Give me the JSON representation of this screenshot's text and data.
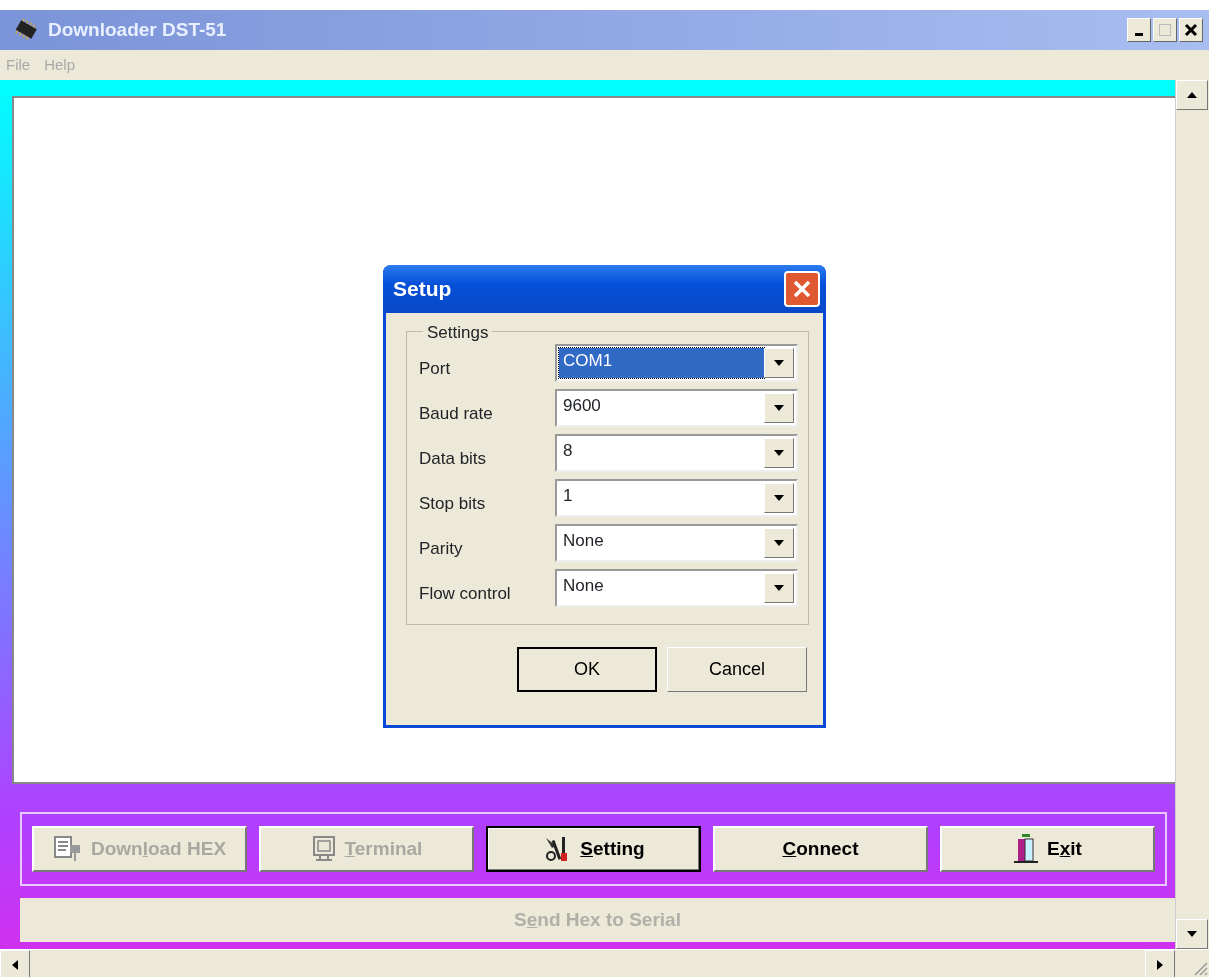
{
  "window": {
    "title": "Downloader DST-51"
  },
  "menu": [
    {
      "label": "File",
      "disabled": true
    },
    {
      "label": "Help",
      "disabled": true
    }
  ],
  "buttons": [
    {
      "kind": "download",
      "label": {
        "before": "Down",
        "key": "l",
        "after": "oad HEX"
      },
      "disabled": true,
      "focused": false
    },
    {
      "kind": "terminal",
      "label": {
        "key": "T",
        "after": "erminal"
      },
      "disabled": true,
      "focused": false
    },
    {
      "kind": "setting",
      "label": {
        "key": "S",
        "after": "etting"
      },
      "disabled": false,
      "focused": true
    },
    {
      "kind": "connect",
      "label": {
        "key": "C",
        "after": "onnect"
      },
      "disabled": false,
      "focused": false
    },
    {
      "kind": "exit",
      "label": {
        "before": "E",
        "key": "x",
        "after": "it"
      },
      "disabled": false,
      "focused": false
    }
  ],
  "status_bar": {
    "label": {
      "before": "S",
      "key": "e",
      "after": "nd Hex to Serial"
    },
    "disabled": true
  },
  "dialog": {
    "title": "Setup",
    "group": "Settings",
    "fields": [
      {
        "label": "Port",
        "value": "COM1",
        "highlighted": true
      },
      {
        "label": "Baud rate",
        "value": "9600",
        "highlighted": false
      },
      {
        "label": "Data bits",
        "value": "8",
        "highlighted": false
      },
      {
        "label": "Stop bits",
        "value": "1",
        "highlighted": false
      },
      {
        "label": "Parity",
        "value": "None",
        "highlighted": false
      },
      {
        "label": "Flow control",
        "value": "None",
        "highlighted": false
      }
    ],
    "buttons": [
      {
        "label": "OK",
        "default": true
      },
      {
        "label": "Cancel",
        "default": false
      }
    ]
  }
}
